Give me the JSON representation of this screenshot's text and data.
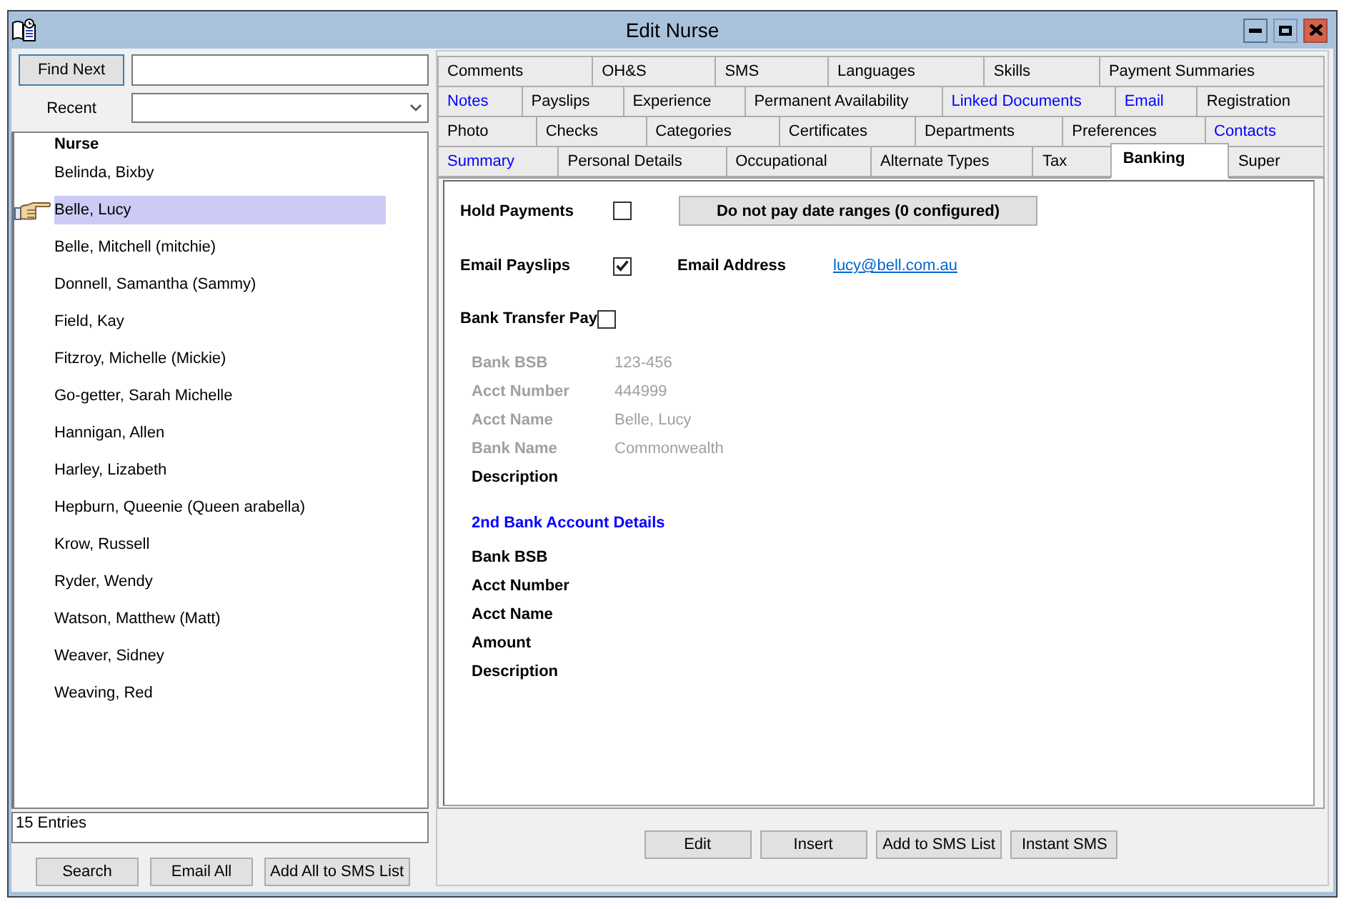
{
  "window": {
    "title": "Edit Nurse"
  },
  "search": {
    "find_button": {
      "label": "Find Next",
      "default": true
    },
    "recent_label": "Recent"
  },
  "nurse_list": {
    "column": "Nurse",
    "rows": [
      {
        "name": "Belinda, Bixby",
        "selected": false
      },
      {
        "name": "Belle, Lucy",
        "selected": true
      },
      {
        "name": "Belle, Mitchell (mitchie)",
        "selected": false
      },
      {
        "name": "Donnell, Samantha (Sammy)",
        "selected": false
      },
      {
        "name": "Field, Kay",
        "selected": false
      },
      {
        "name": "Fitzroy, Michelle (Mickie)",
        "selected": false
      },
      {
        "name": "Go-getter, Sarah Michelle",
        "selected": false
      },
      {
        "name": "Hannigan, Allen",
        "selected": false
      },
      {
        "name": "Harley, Lizabeth",
        "selected": false
      },
      {
        "name": "Hepburn, Queenie (Queen arabella)",
        "selected": false
      },
      {
        "name": "Krow, Russell",
        "selected": false
      },
      {
        "name": "Ryder, Wendy",
        "selected": false
      },
      {
        "name": "Watson, Matthew (Matt)",
        "selected": false
      },
      {
        "name": "Weaver, Sidney",
        "selected": false
      },
      {
        "name": "Weaving, Red",
        "selected": false
      }
    ]
  },
  "entry_count": "15 Entries",
  "list_buttons": [
    "Search",
    "Email All",
    "Add All to SMS List"
  ],
  "tab_rows": [
    {
      "tabs": [
        {
          "label": "Comments",
          "selected": false,
          "highlighted": false
        },
        {
          "label": "OH&S",
          "selected": false,
          "highlighted": false
        },
        {
          "label": "SMS",
          "selected": false,
          "highlighted": false
        },
        {
          "label": "Languages",
          "selected": false,
          "highlighted": false
        },
        {
          "label": "Skills",
          "selected": false,
          "highlighted": false
        },
        {
          "label": "Payment Summaries",
          "selected": false,
          "highlighted": false
        }
      ]
    },
    {
      "tabs": [
        {
          "label": "Notes",
          "selected": false,
          "highlighted": true
        },
        {
          "label": "Payslips",
          "selected": false,
          "highlighted": false
        },
        {
          "label": "Experience",
          "selected": false,
          "highlighted": false
        },
        {
          "label": "Permanent Availability",
          "selected": false,
          "highlighted": false
        },
        {
          "label": "Linked Documents",
          "selected": false,
          "highlighted": true
        },
        {
          "label": "Email",
          "selected": false,
          "highlighted": true
        },
        {
          "label": "Registration",
          "selected": false,
          "highlighted": false
        }
      ]
    },
    {
      "tabs": [
        {
          "label": "Photo",
          "selected": false,
          "highlighted": false
        },
        {
          "label": "Checks",
          "selected": false,
          "highlighted": false
        },
        {
          "label": "Categories",
          "selected": false,
          "highlighted": false
        },
        {
          "label": "Certificates",
          "selected": false,
          "highlighted": false
        },
        {
          "label": "Departments",
          "selected": false,
          "highlighted": false
        },
        {
          "label": "Preferences",
          "selected": false,
          "highlighted": false
        },
        {
          "label": "Contacts",
          "selected": false,
          "highlighted": true
        }
      ]
    },
    {
      "tabs": [
        {
          "label": "Summary",
          "selected": false,
          "highlighted": true
        },
        {
          "label": "Personal Details",
          "selected": false,
          "highlighted": false
        },
        {
          "label": "Occupational",
          "selected": false,
          "highlighted": false
        },
        {
          "label": "Alternate Types",
          "selected": false,
          "highlighted": false
        },
        {
          "label": "Tax",
          "selected": false,
          "highlighted": false
        },
        {
          "label": "Banking",
          "selected": true,
          "highlighted": false
        },
        {
          "label": "Super",
          "selected": false,
          "highlighted": false
        }
      ]
    }
  ],
  "banking": {
    "hold_payments": {
      "label": "Hold Payments",
      "checked": false
    },
    "date_ranges_button": "Do not pay date ranges (0 configured)",
    "email_payslips": {
      "label": "Email Payslips",
      "checked": true
    },
    "email_address": {
      "label": "Email Address",
      "value": "lucy@bell.com.au"
    },
    "bank_transfer_pay": {
      "label": "Bank Transfer Pay",
      "checked": false
    },
    "bank_account": [
      {
        "label": "Bank BSB",
        "value": "123-456",
        "disabled": true
      },
      {
        "label": "Acct Number",
        "value": "444999",
        "disabled": true
      },
      {
        "label": "Acct Name",
        "value": "Belle, Lucy",
        "disabled": true
      },
      {
        "label": "Bank Name",
        "value": "Commonwealth",
        "disabled": true
      },
      {
        "label": "Description",
        "disabled": false
      }
    ],
    "second_account": {
      "heading": "2nd Bank Account Details",
      "fields": [
        {
          "label": "Bank BSB",
          "disabled": false
        },
        {
          "label": "Acct Number",
          "disabled": false
        },
        {
          "label": "Acct Name",
          "disabled": false
        },
        {
          "label": "Amount",
          "disabled": false
        },
        {
          "label": "Description",
          "disabled": false
        }
      ]
    }
  },
  "action_buttons": [
    "Edit",
    "Insert",
    "Add to SMS List",
    "Instant SMS"
  ]
}
